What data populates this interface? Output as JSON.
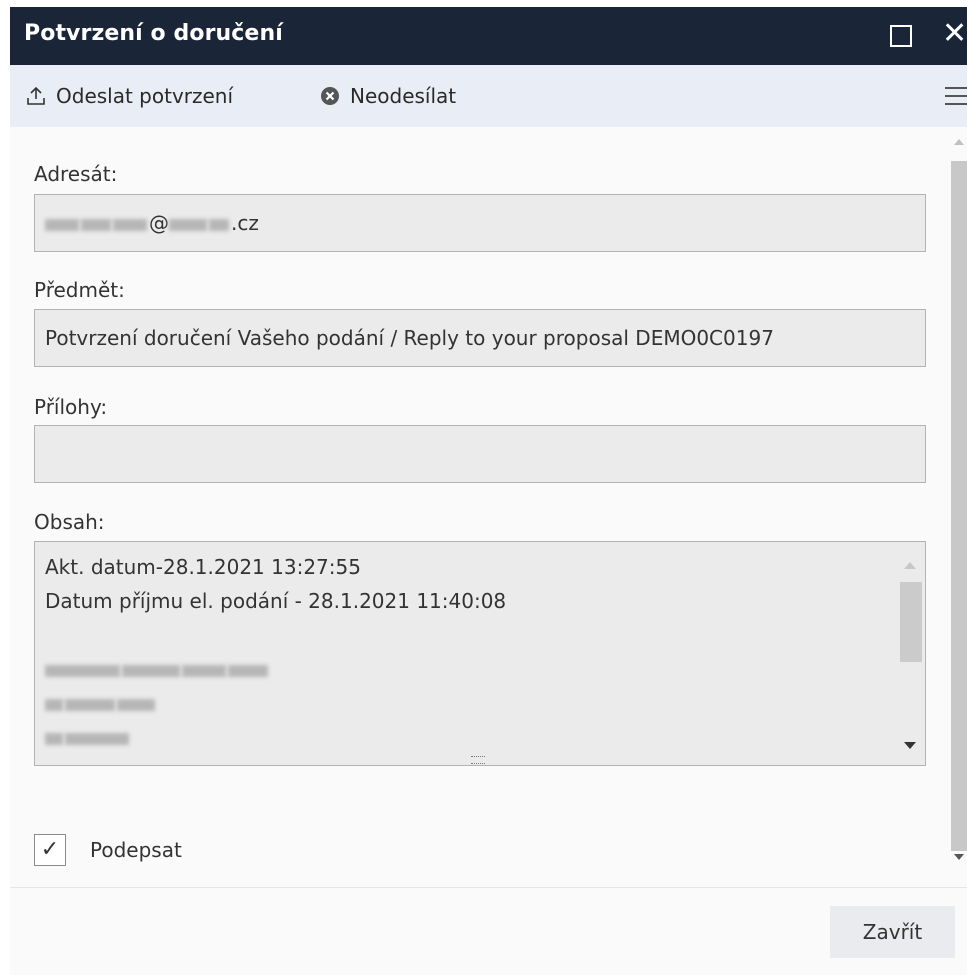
{
  "window": {
    "title": "Potvrzení o doručení"
  },
  "toolbar": {
    "send_label": "Odeslat potvrzení",
    "cancel_label": "Neodesílat"
  },
  "form": {
    "recipient_label": "Adresát:",
    "recipient_value_suffix": "@",
    "recipient_value_end": ".cz",
    "subject_label": "Předmět:",
    "subject_value": "Potvrzení doručení Vašeho podání / Reply to your proposal DEMO0C0197",
    "attachments_label": "Přílohy:",
    "attachments_value": "",
    "content_label": "Obsah:",
    "content_lines": [
      "Akt. datum-28.1.2021 13:27:55",
      "Datum příjmu el. podání - 28.1.2021 11:40:08"
    ],
    "sign_label": "Podepsat",
    "sign_checked_glyph": "✓"
  },
  "footer": {
    "close_label": "Zavřít"
  },
  "colors": {
    "titlebar": "#1b2538",
    "toolbar": "#e9edf5",
    "field_bg": "#ebebeb"
  }
}
